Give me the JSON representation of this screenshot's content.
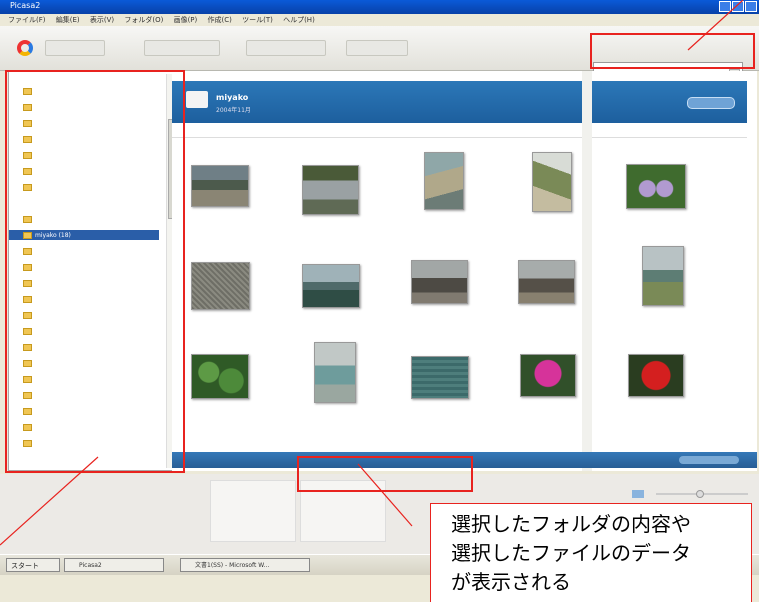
{
  "window": {
    "title": "Picasa2"
  },
  "menubar": [
    "ファイル(F)",
    "編集(E)",
    "表示(V)",
    "フォルダ(O)",
    "画像(P)",
    "作成(C)",
    "ツール(T)",
    "ヘルプ(H)"
  ],
  "sidebar": {
    "selected_folder": "miyako (18)"
  },
  "content": {
    "folder_name": "miyako",
    "folder_date": "2004年11月"
  },
  "taskbar": {
    "start_label": "スタート",
    "task_1": "Picasa2",
    "task_2": "文書1(SS) - Microsoft W..."
  },
  "annotation": {
    "lines": [
      "選択したフォルダの内容や",
      "選択したファイルのデータ",
      "が表示される"
    ]
  },
  "colors": {
    "highlight": "#e8231f",
    "selection": "#2a5ea8",
    "header": "#2c78b8"
  }
}
